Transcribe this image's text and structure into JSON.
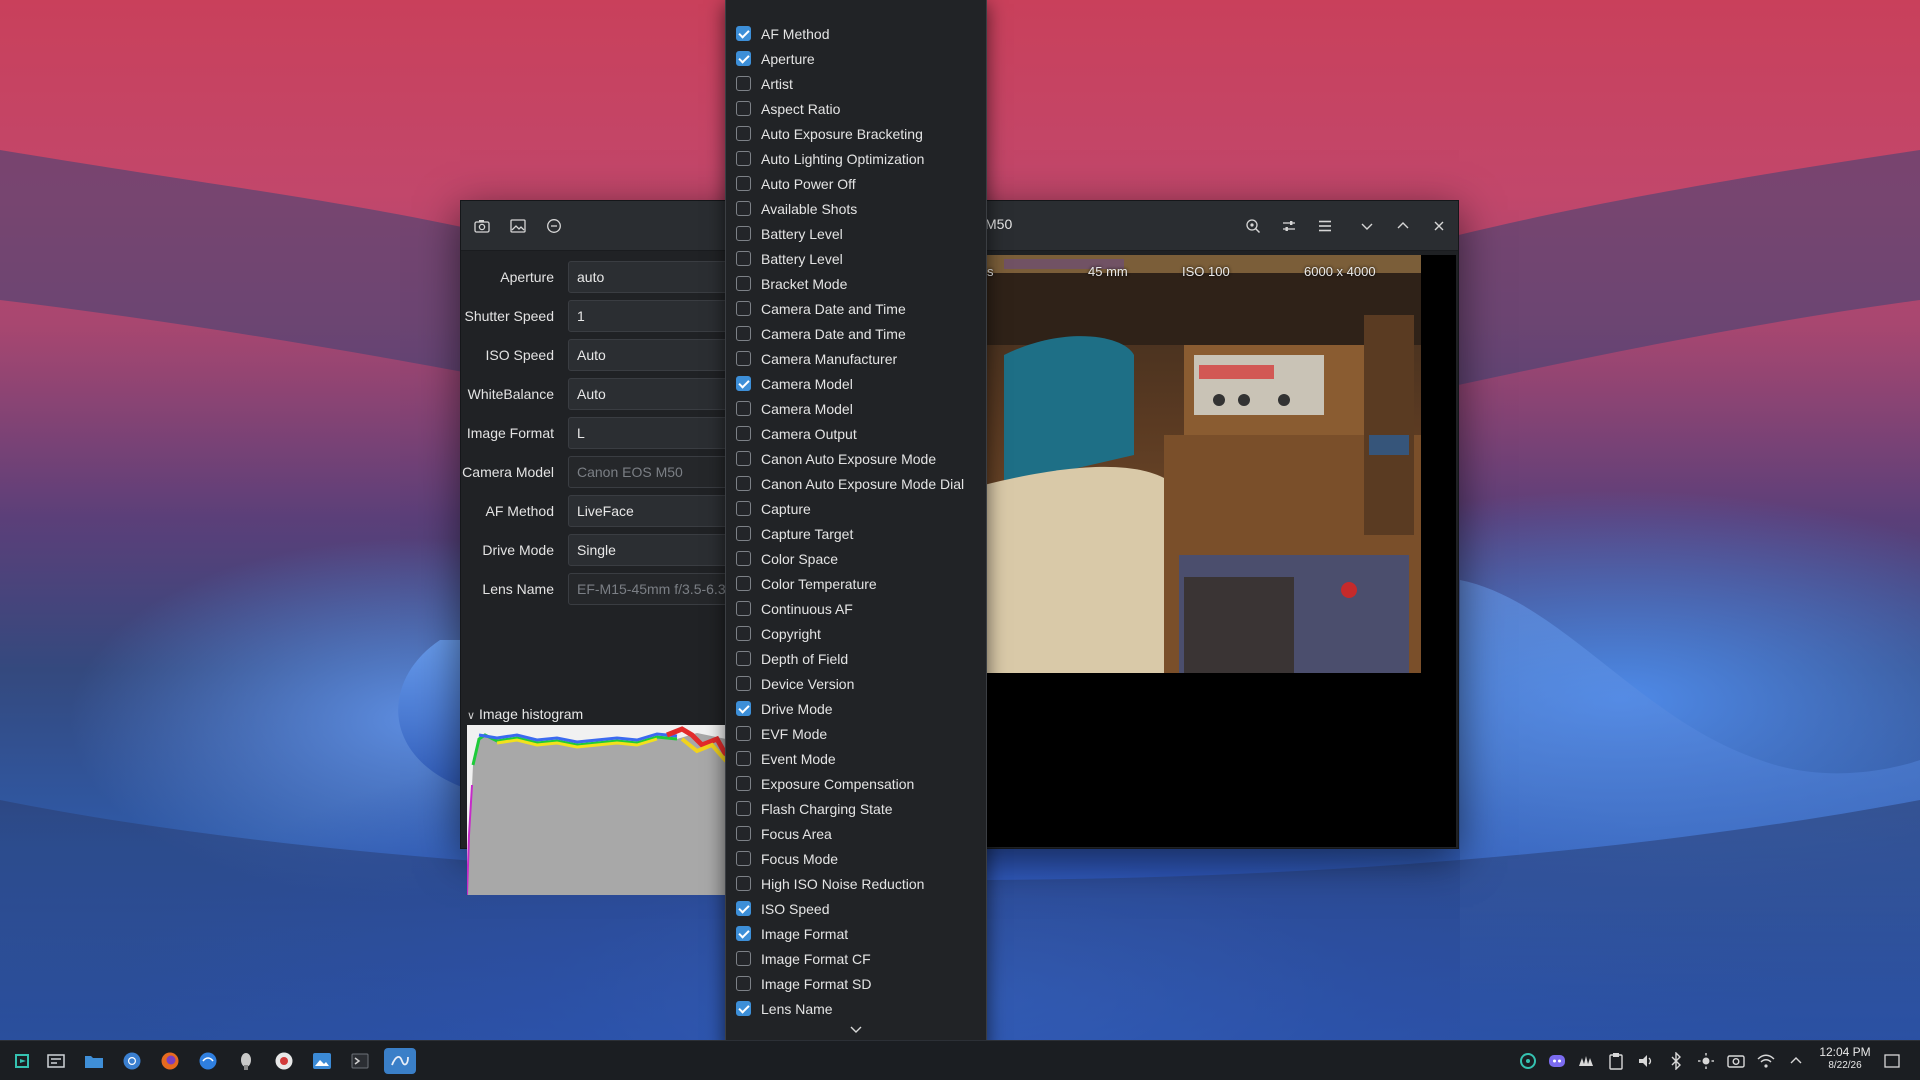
{
  "window": {
    "title": "M50",
    "toolbar_left_icons": [
      "camera-icon",
      "image-icon",
      "minus-circle-icon"
    ],
    "toolbar_right_icons": [
      "zoom-icon",
      "adjust-icon",
      "menu-icon"
    ],
    "controls": [
      "minimize-chevron-icon",
      "maximize-chevron-icon",
      "close-icon"
    ]
  },
  "settings": [
    {
      "label": "Aperture",
      "value": "auto",
      "readonly": false
    },
    {
      "label": "Shutter Speed",
      "value": "1",
      "readonly": false
    },
    {
      "label": "ISO Speed",
      "value": "Auto",
      "readonly": false
    },
    {
      "label": "WhiteBalance",
      "value": "Auto",
      "readonly": false
    },
    {
      "label": "Image Format",
      "value": "L",
      "readonly": false
    },
    {
      "label": "Camera Model",
      "value": "Canon EOS M50",
      "readonly": true
    },
    {
      "label": "AF Method",
      "value": "LiveFace",
      "readonly": false
    },
    {
      "label": "Drive Mode",
      "value": "Single",
      "readonly": false
    },
    {
      "label": "Lens Name",
      "value": "EF-M15-45mm f/3.5-6.3",
      "readonly": true
    }
  ],
  "histogram": {
    "header": "Image histogram"
  },
  "preview": {
    "overlay": {
      "left": "s",
      "focal": "45 mm",
      "iso": "ISO 100",
      "resolution": "6000 x 4000"
    }
  },
  "property_list": [
    {
      "label": "AF Method",
      "checked": true
    },
    {
      "label": "Aperture",
      "checked": true
    },
    {
      "label": "Artist",
      "checked": false
    },
    {
      "label": "Aspect Ratio",
      "checked": false
    },
    {
      "label": "Auto Exposure Bracketing",
      "checked": false
    },
    {
      "label": "Auto Lighting Optimization",
      "checked": false
    },
    {
      "label": "Auto Power Off",
      "checked": false
    },
    {
      "label": "Available Shots",
      "checked": false
    },
    {
      "label": "Battery Level",
      "checked": false
    },
    {
      "label": "Battery Level",
      "checked": false
    },
    {
      "label": "Bracket Mode",
      "checked": false
    },
    {
      "label": "Camera Date and Time",
      "checked": false
    },
    {
      "label": "Camera Date and Time",
      "checked": false
    },
    {
      "label": "Camera Manufacturer",
      "checked": false
    },
    {
      "label": "Camera Model",
      "checked": true
    },
    {
      "label": "Camera Model",
      "checked": false
    },
    {
      "label": "Camera Output",
      "checked": false
    },
    {
      "label": "Canon Auto Exposure Mode",
      "checked": false
    },
    {
      "label": "Canon Auto Exposure Mode Dial",
      "checked": false
    },
    {
      "label": "Capture",
      "checked": false
    },
    {
      "label": "Capture Target",
      "checked": false
    },
    {
      "label": "Color Space",
      "checked": false
    },
    {
      "label": "Color Temperature",
      "checked": false
    },
    {
      "label": "Continuous AF",
      "checked": false
    },
    {
      "label": "Copyright",
      "checked": false
    },
    {
      "label": "Depth of Field",
      "checked": false
    },
    {
      "label": "Device Version",
      "checked": false
    },
    {
      "label": "Drive Mode",
      "checked": true
    },
    {
      "label": "EVF Mode",
      "checked": false
    },
    {
      "label": "Event Mode",
      "checked": false
    },
    {
      "label": "Exposure Compensation",
      "checked": false
    },
    {
      "label": "Flash Charging State",
      "checked": false
    },
    {
      "label": "Focus Area",
      "checked": false
    },
    {
      "label": "Focus Mode",
      "checked": false
    },
    {
      "label": "High ISO Noise Reduction",
      "checked": false
    },
    {
      "label": "ISO Speed",
      "checked": true
    },
    {
      "label": "Image Format",
      "checked": true
    },
    {
      "label": "Image Format CF",
      "checked": false
    },
    {
      "label": "Image Format SD",
      "checked": false
    },
    {
      "label": "Lens Name",
      "checked": true
    }
  ],
  "taskbar": {
    "apps": [
      "start-menu-icon",
      "task-manager-icon",
      "file-manager-icon",
      "chromium-icon",
      "firefox-icon",
      "browser-icon",
      "game-icon",
      "circle-app-icon",
      "photo-app-icon",
      "terminal-icon",
      "entangle-icon"
    ],
    "active_app": "entangle-icon",
    "tray": [
      "sync-icon",
      "discord-icon",
      "steam-icon",
      "clipboard-icon",
      "volume-icon",
      "bluetooth-icon",
      "brightness-icon",
      "screenshot-icon",
      "wifi-icon",
      "expand-tray-icon"
    ],
    "time": "12:04 PM",
    "date": "8/22/26"
  },
  "colors": {
    "accent": "#3d8fd8",
    "panel": "#212326",
    "taskbar": "#1b1e22"
  }
}
